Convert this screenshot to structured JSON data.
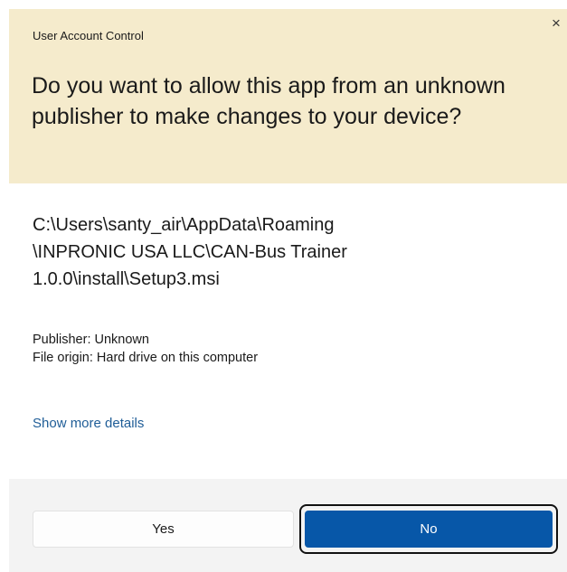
{
  "dialog": {
    "title": "User Account Control",
    "close_glyph": "×",
    "question": "Do you want to allow this app from an unknown publisher to make changes to your device?",
    "app_path_lines": [
      "C:\\Users\\santy_air\\AppData\\Roaming",
      "\\INPRONIC USA LLC\\CAN-Bus Trainer",
      "1.0.0\\install\\Setup3.msi"
    ],
    "publisher": "Publisher: Unknown",
    "file_origin": "File origin: Hard drive on this computer",
    "more_details": "Show more details",
    "buttons": {
      "yes": "Yes",
      "no": "No"
    }
  },
  "colors": {
    "header_bg": "#f5ebcc",
    "footer_bg": "#f3f3f3",
    "primary_button": "#0757a8",
    "link": "#1f5d97"
  }
}
